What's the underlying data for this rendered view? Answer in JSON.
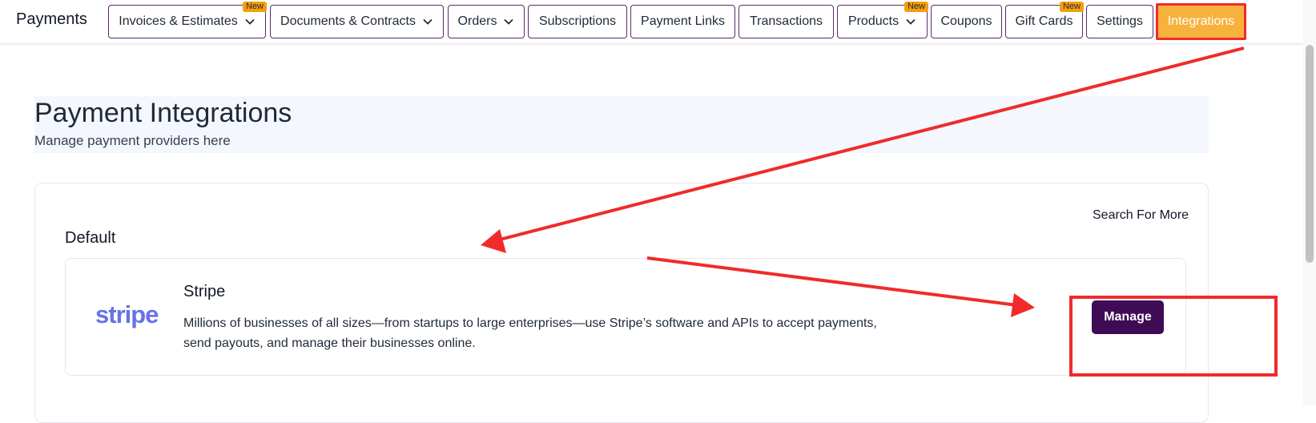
{
  "topbar": {
    "title": "Payments",
    "tabs": [
      {
        "label": "Invoices & Estimates",
        "dropdown": true,
        "badge": "New"
      },
      {
        "label": "Documents & Contracts",
        "dropdown": true,
        "badge": ""
      },
      {
        "label": "Orders",
        "dropdown": true,
        "badge": ""
      },
      {
        "label": "Subscriptions",
        "dropdown": false,
        "badge": ""
      },
      {
        "label": "Payment Links",
        "dropdown": false,
        "badge": ""
      },
      {
        "label": "Transactions",
        "dropdown": false,
        "badge": ""
      },
      {
        "label": "Products",
        "dropdown": true,
        "badge": "New"
      },
      {
        "label": "Coupons",
        "dropdown": false,
        "badge": ""
      },
      {
        "label": "Gift Cards",
        "dropdown": false,
        "badge": "New"
      },
      {
        "label": "Settings",
        "dropdown": false,
        "badge": ""
      },
      {
        "label": "Integrations",
        "dropdown": false,
        "badge": "",
        "active": true
      }
    ]
  },
  "header": {
    "title": "Payment Integrations",
    "subtitle": "Manage payment providers here"
  },
  "card": {
    "search_more": "Search For More",
    "section_heading": "Default",
    "integrations": [
      {
        "logo_text": "stripe",
        "name": "Stripe",
        "description": "Millions of businesses of all sizes—from startups to large enterprises—use Stripe’s software and APIs to accept payments, send payouts, and manage their businesses online.",
        "action_label": "Manage"
      }
    ]
  },
  "colors": {
    "tab_border": "#5b2a6e",
    "active_tab_bg": "#f6b23c",
    "badge_bg": "#f59e0b",
    "manage_button_bg": "#3f0b55",
    "stripe_brand": "#6772e5",
    "annotation_red": "#ef2b2b",
    "header_bg": "#f4f7fe"
  }
}
